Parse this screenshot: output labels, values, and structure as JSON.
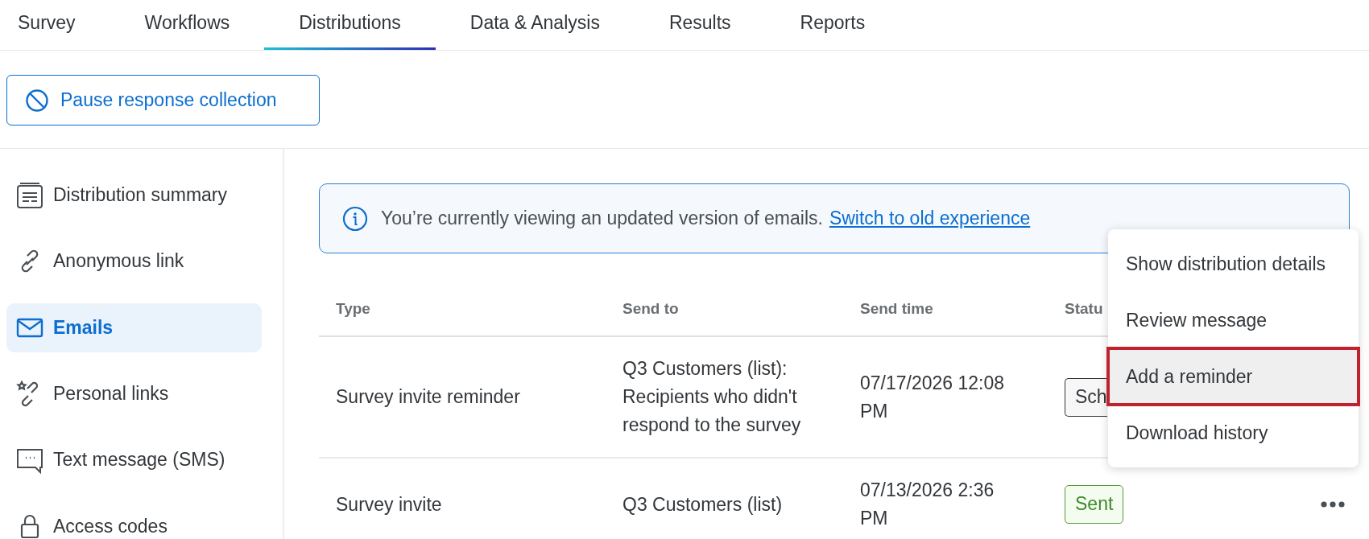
{
  "tabs": [
    {
      "label": "Survey",
      "selected": false
    },
    {
      "label": "Workflows",
      "selected": false
    },
    {
      "label": "Distributions",
      "selected": true
    },
    {
      "label": "Data & Analysis",
      "selected": false
    },
    {
      "label": "Results",
      "selected": false
    },
    {
      "label": "Reports",
      "selected": false
    }
  ],
  "pause_button": {
    "label": "Pause response collection"
  },
  "sidebar": {
    "items": [
      {
        "label": "Distribution summary",
        "kind": "summary",
        "selected": false
      },
      {
        "label": "Anonymous link",
        "kind": "link",
        "selected": false
      },
      {
        "label": "Emails",
        "kind": "email",
        "selected": true
      },
      {
        "label": "Personal links",
        "kind": "personal",
        "selected": false
      },
      {
        "label": "Text message (SMS)",
        "kind": "sms",
        "selected": false
      },
      {
        "label": "Access codes",
        "kind": "lock",
        "selected": false
      }
    ]
  },
  "banner": {
    "text": "You’re currently viewing an updated version of emails.",
    "link": "Switch to old experience"
  },
  "table": {
    "columns": [
      "Type",
      "Send to",
      "Send time",
      "Statu"
    ],
    "rows": [
      {
        "type": "Survey invite reminder",
        "send_to": "Q3 Customers (list): Recipients who didn't respond to the survey",
        "send_time": "07/17/2026 12:08 PM",
        "status": {
          "label": "Sch",
          "kind": "scheduled"
        },
        "menu_open": true
      },
      {
        "type": "Survey invite",
        "send_to": "Q3 Customers (list)",
        "send_time": "07/13/2026 2:36 PM",
        "status": {
          "label": "Sent",
          "kind": "sent"
        },
        "menu_open": false
      }
    ]
  },
  "row_menu": {
    "items": [
      {
        "label": "Show distribution details",
        "selected": false
      },
      {
        "label": "Review message",
        "selected": false
      },
      {
        "label": "Add a reminder",
        "selected": true
      },
      {
        "label": "Download history",
        "selected": false
      }
    ]
  }
}
